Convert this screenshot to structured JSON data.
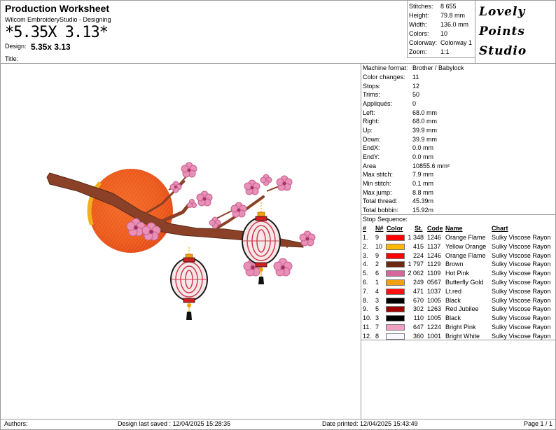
{
  "header": {
    "title": "Production Worksheet",
    "app": "Wilcom EmbroideryStudio - Designing",
    "design_big": "*5.35X 3.13*",
    "design_label": "Design:",
    "design_value": "5.35x 3.13",
    "title_label": "Title:"
  },
  "stats": [
    {
      "k": "Stitches:",
      "v": "8 655"
    },
    {
      "k": "Height:",
      "v": "79.8 mm"
    },
    {
      "k": "Width:",
      "v": "136.0 mm"
    },
    {
      "k": "Colors:",
      "v": "10"
    },
    {
      "k": "Colorway:",
      "v": "Colorway 1"
    },
    {
      "k": "Zoom:",
      "v": "1:1"
    }
  ],
  "logo": {
    "line1": "Lovely",
    "line2": "Points",
    "line3": "Studio"
  },
  "machine": [
    {
      "k": "Machine format:",
      "v": "Brother / Babylock"
    },
    {
      "k": "Color changes:",
      "v": "11"
    },
    {
      "k": "Stops:",
      "v": "12"
    },
    {
      "k": "Trims:",
      "v": "50"
    },
    {
      "k": "Appliqués:",
      "v": "0"
    },
    {
      "k": "Left:",
      "v": "68.0 mm"
    },
    {
      "k": "Right:",
      "v": "68.0 mm"
    },
    {
      "k": "Up:",
      "v": "39.9 mm"
    },
    {
      "k": "Down:",
      "v": "39.9 mm"
    },
    {
      "k": "EndX:",
      "v": "0.0 mm"
    },
    {
      "k": "EndY:",
      "v": "0.0 mm"
    },
    {
      "k": "Area",
      "v": "10855.6 mm²"
    },
    {
      "k": "Max stitch:",
      "v": "7.9 mm"
    },
    {
      "k": "Min stitch:",
      "v": "0.1 mm"
    },
    {
      "k": "Max jump:",
      "v": "8.8 mm"
    },
    {
      "k": "Total thread:",
      "v": "45.39m"
    },
    {
      "k": "Total bobbin:",
      "v": "15.92m"
    }
  ],
  "sequence": {
    "title": "Stop Sequence:",
    "headers": {
      "num": "#",
      "n": "N#",
      "color": "Color",
      "st": "St.",
      "code": "Code",
      "name": "Name",
      "chart": "Chart"
    },
    "rows": [
      {
        "num": "1.",
        "n": "9",
        "hex": "#ff0000",
        "st": "1 348",
        "code": "1246",
        "name": "Orange Flame",
        "chart": "Sulky Viscose Rayon"
      },
      {
        "num": "2.",
        "n": "10",
        "hex": "#ffb800",
        "st": "415",
        "code": "1137",
        "name": "Yellow Orange",
        "chart": "Sulky Viscose Rayon"
      },
      {
        "num": "3.",
        "n": "9",
        "hex": "#ff0000",
        "st": "224",
        "code": "1246",
        "name": "Orange Flame",
        "chart": "Sulky Viscose Rayon"
      },
      {
        "num": "4.",
        "n": "2",
        "hex": "#6b2a10",
        "st": "1 797",
        "code": "1129",
        "name": "Brown",
        "chart": "Sulky Viscose Rayon"
      },
      {
        "num": "5.",
        "n": "6",
        "hex": "#d4689a",
        "st": "2 062",
        "code": "1109",
        "name": "Hot Pink",
        "chart": "Sulky Viscose Rayon"
      },
      {
        "num": "6.",
        "n": "1",
        "hex": "#f0a010",
        "st": "249",
        "code": "0567",
        "name": "Butterfly Gold",
        "chart": "Sulky Viscose Rayon"
      },
      {
        "num": "7.",
        "n": "4",
        "hex": "#ff1010",
        "st": "471",
        "code": "1037",
        "name": "Lt.red",
        "chart": "Sulky Viscose Rayon"
      },
      {
        "num": "8.",
        "n": "3",
        "hex": "#000000",
        "st": "670",
        "code": "1005",
        "name": "Black",
        "chart": "Sulky Viscose Rayon"
      },
      {
        "num": "9.",
        "n": "5",
        "hex": "#a00000",
        "st": "302",
        "code": "1263",
        "name": "Red Jubilee",
        "chart": "Sulky Viscose Rayon"
      },
      {
        "num": "10.",
        "n": "3",
        "hex": "#000000",
        "st": "110",
        "code": "1005",
        "name": "Black",
        "chart": "Sulky Viscose Rayon"
      },
      {
        "num": "11.",
        "n": "7",
        "hex": "#f0a0c0",
        "st": "647",
        "code": "1224",
        "name": "Bright Pink",
        "chart": "Sulky Viscose Rayon"
      },
      {
        "num": "12.",
        "n": "8",
        "hex": "#f8f8ff",
        "st": "360",
        "code": "1001",
        "name": "Bright White",
        "chart": "Sulky Viscose Rayon"
      }
    ]
  },
  "footer": {
    "authors": "Authors:",
    "saved": "Design last saved : 12/04/2025 15:28:35",
    "printed": "Date printed: 12/04/2025 15:43:49",
    "page": "Page 1 / 1"
  }
}
